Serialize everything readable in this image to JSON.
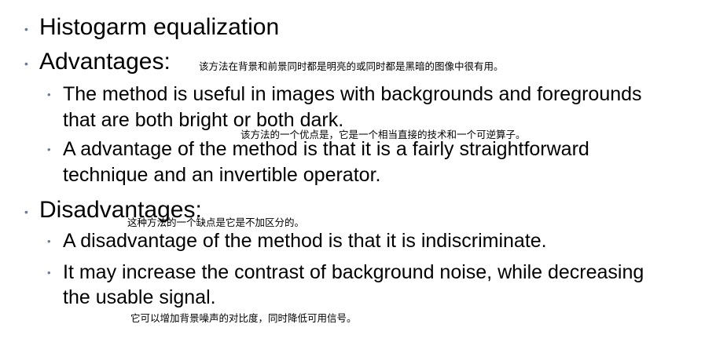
{
  "slide": {
    "items": [
      {
        "text": "Histogarm equalization"
      },
      {
        "text": "Advantages:"
      },
      {
        "text_line1": "The method is useful in images with backgrounds and foregrounds",
        "text_line2": "that are both bright or both dark."
      },
      {
        "text_line1": "A advantage of the method is that it is a fairly straightforward",
        "text_line2": "technique and an invertible operator."
      },
      {
        "text": "Disadvantages:"
      },
      {
        "text": "A disadvantage of the method is that it is indiscriminate."
      },
      {
        "text_line1": "It may increase the contrast of background noise, while decreasing",
        "text_line2": "the usable signal."
      }
    ],
    "bullet_glyph": "•",
    "notes": [
      {
        "text": "该方法在背景和前景同时都是明亮的或同时都是黑暗的图像中很有用。"
      },
      {
        "text": "该方法的一个优点是，它是一个相当直接的技术和一个可逆算子。"
      },
      {
        "text": "这种方法的一个缺点是它是不加区分的。"
      },
      {
        "text": "它可以增加背景噪声的对比度，同时降低可用信号。"
      }
    ]
  },
  "colors": {
    "bullet": "#6b7b93",
    "text": "#000000",
    "background": "#ffffff"
  }
}
